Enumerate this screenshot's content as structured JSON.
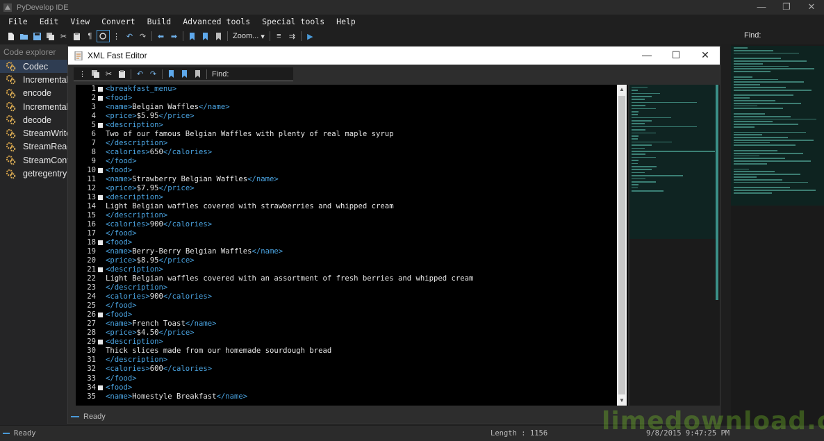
{
  "app": {
    "title": "PyDevelop IDE",
    "window_controls": [
      "—",
      "❐",
      "✕"
    ]
  },
  "menu": [
    "File",
    "Edit",
    "View",
    "Convert",
    "Build",
    "Advanced tools",
    "Special tools",
    "Help"
  ],
  "toolbar": {
    "zoom_label": "Zoom...",
    "find_label": "Find:"
  },
  "explorer": {
    "title": "Code explorer",
    "items": [
      "Codec",
      "Incremental",
      "encode",
      "Incremental",
      "decode",
      "StreamWrite",
      "StreamRead",
      "StreamConv",
      "getregentry"
    ],
    "selected_index": 0
  },
  "dialog": {
    "title": "XML Fast Editor",
    "window_controls": [
      "—",
      "☐",
      "✕"
    ],
    "find_label": "Find:",
    "status": "Ready"
  },
  "editor": {
    "lines": [
      {
        "n": "1",
        "fold": true,
        "parts": [
          [
            "t",
            "<"
          ],
          [
            "t",
            "breakfast_menu"
          ],
          [
            "t",
            ">"
          ]
        ]
      },
      {
        "n": "2",
        "fold": true,
        "parts": [
          [
            "t",
            "<food>"
          ]
        ]
      },
      {
        "n": "3",
        "fold": false,
        "parts": [
          [
            "t",
            "<name>"
          ],
          [
            "p",
            "Belgian Waffles"
          ],
          [
            "t",
            "</name>"
          ]
        ]
      },
      {
        "n": "4",
        "fold": false,
        "parts": [
          [
            "t",
            "<price>"
          ],
          [
            "p",
            "$5.95"
          ],
          [
            "t",
            "</price>"
          ]
        ]
      },
      {
        "n": "5",
        "fold": true,
        "parts": [
          [
            "t",
            "<description>"
          ]
        ]
      },
      {
        "n": "6",
        "fold": false,
        "parts": [
          [
            "p",
            "Two of our famous Belgian Waffles with plenty of real maple syrup"
          ]
        ]
      },
      {
        "n": "7",
        "fold": false,
        "parts": [
          [
            "t",
            "</description>"
          ]
        ]
      },
      {
        "n": "8",
        "fold": false,
        "parts": [
          [
            "t",
            "<calories>"
          ],
          [
            "p",
            "650"
          ],
          [
            "t",
            "</calories>"
          ]
        ]
      },
      {
        "n": "9",
        "fold": false,
        "parts": [
          [
            "t",
            "</food>"
          ]
        ]
      },
      {
        "n": "10",
        "fold": true,
        "parts": [
          [
            "t",
            "<food>"
          ]
        ]
      },
      {
        "n": "11",
        "fold": false,
        "parts": [
          [
            "t",
            "<name>"
          ],
          [
            "p",
            "Strawberry Belgian Waffles"
          ],
          [
            "t",
            "</name>"
          ]
        ]
      },
      {
        "n": "12",
        "fold": false,
        "parts": [
          [
            "t",
            "<price>"
          ],
          [
            "p",
            "$7.95"
          ],
          [
            "t",
            "</price>"
          ]
        ]
      },
      {
        "n": "13",
        "fold": true,
        "parts": [
          [
            "t",
            "<description>"
          ]
        ]
      },
      {
        "n": "14",
        "fold": false,
        "parts": [
          [
            "p",
            "Light Belgian waffles covered with strawberries and whipped cream"
          ]
        ]
      },
      {
        "n": "15",
        "fold": false,
        "parts": [
          [
            "t",
            "</description>"
          ]
        ]
      },
      {
        "n": "16",
        "fold": false,
        "parts": [
          [
            "t",
            "<calories>"
          ],
          [
            "p",
            "900"
          ],
          [
            "t",
            "</calories>"
          ]
        ]
      },
      {
        "n": "17",
        "fold": false,
        "parts": [
          [
            "t",
            "</food>"
          ]
        ]
      },
      {
        "n": "18",
        "fold": true,
        "parts": [
          [
            "t",
            "<food>"
          ]
        ]
      },
      {
        "n": "19",
        "fold": false,
        "parts": [
          [
            "t",
            "<name>"
          ],
          [
            "p",
            "Berry-Berry Belgian Waffles"
          ],
          [
            "t",
            "</name>"
          ]
        ]
      },
      {
        "n": "20",
        "fold": false,
        "parts": [
          [
            "t",
            "<price>"
          ],
          [
            "p",
            "$8.95"
          ],
          [
            "t",
            "</price>"
          ]
        ]
      },
      {
        "n": "21",
        "fold": true,
        "parts": [
          [
            "t",
            "<description>"
          ]
        ]
      },
      {
        "n": "22",
        "fold": false,
        "parts": [
          [
            "p",
            "Light Belgian waffles covered with an assortment of fresh berries and whipped cream"
          ]
        ]
      },
      {
        "n": "23",
        "fold": false,
        "parts": [
          [
            "t",
            "</description>"
          ]
        ]
      },
      {
        "n": "24",
        "fold": false,
        "parts": [
          [
            "t",
            "<calories>"
          ],
          [
            "p",
            "900"
          ],
          [
            "t",
            "</calories>"
          ]
        ]
      },
      {
        "n": "25",
        "fold": false,
        "parts": [
          [
            "t",
            "</food>"
          ]
        ]
      },
      {
        "n": "26",
        "fold": true,
        "parts": [
          [
            "t",
            "<food>"
          ]
        ]
      },
      {
        "n": "27",
        "fold": false,
        "parts": [
          [
            "t",
            "<name>"
          ],
          [
            "p",
            "French Toast"
          ],
          [
            "t",
            "</name>"
          ]
        ]
      },
      {
        "n": "28",
        "fold": false,
        "parts": [
          [
            "t",
            "<price>"
          ],
          [
            "p",
            "$4.50"
          ],
          [
            "t",
            "</price>"
          ]
        ]
      },
      {
        "n": "29",
        "fold": true,
        "parts": [
          [
            "t",
            "<description>"
          ]
        ]
      },
      {
        "n": "30",
        "fold": false,
        "parts": [
          [
            "p",
            "Thick slices made from our homemade sourdough bread"
          ]
        ]
      },
      {
        "n": "31",
        "fold": false,
        "parts": [
          [
            "t",
            "</description>"
          ]
        ]
      },
      {
        "n": "32",
        "fold": false,
        "parts": [
          [
            "t",
            "<calories>"
          ],
          [
            "p",
            "600"
          ],
          [
            "t",
            "</calories>"
          ]
        ]
      },
      {
        "n": "33",
        "fold": false,
        "parts": [
          [
            "t",
            "</food>"
          ]
        ]
      },
      {
        "n": "34",
        "fold": true,
        "parts": [
          [
            "t",
            "<food>"
          ]
        ]
      },
      {
        "n": "35",
        "fold": false,
        "parts": [
          [
            "t",
            "<name>"
          ],
          [
            "p",
            "Homestyle Breakfast"
          ],
          [
            "t",
            "</name>"
          ]
        ]
      }
    ]
  },
  "statusbar": {
    "ready": "Ready",
    "length": "Length : 1156",
    "datetime": "9/8/2015 9:47:25 PM"
  },
  "watermark": "limedownload.com",
  "colors": {
    "tag": "#4aa3e0",
    "text": "#e6e6e6",
    "background": "#000000",
    "accent": "#4a9ad8"
  }
}
